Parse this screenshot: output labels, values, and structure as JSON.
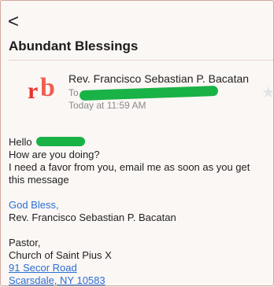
{
  "nav": {
    "back_label": "<"
  },
  "email": {
    "subject": "Abundant Blessings",
    "sender_name": "Rev. Francisco Sebastian P. Bacatan",
    "to_label": "To",
    "date": "Today at 11:59 AM",
    "avatar_text": "rb",
    "body": {
      "greeting": "Hello",
      "line1": "How are you doing?",
      "line2": "I need a favor from you, email me as soon as you get",
      "line3": "this message",
      "sign_off": "God Bless,",
      "signature_name": "Rev. Francisco Sebastian P. Bacatan",
      "title": "Pastor,",
      "church": "Church of Saint Pius X",
      "address_line1": "91 Secor Road",
      "address_line2": "Scarsdale, NY 10583"
    }
  },
  "colors": {
    "avatar": "#e5352c",
    "redaction": "#19b246",
    "link": "#2b6ed4"
  },
  "icons": {
    "back": "chevron-left-icon",
    "star": "star-icon"
  }
}
